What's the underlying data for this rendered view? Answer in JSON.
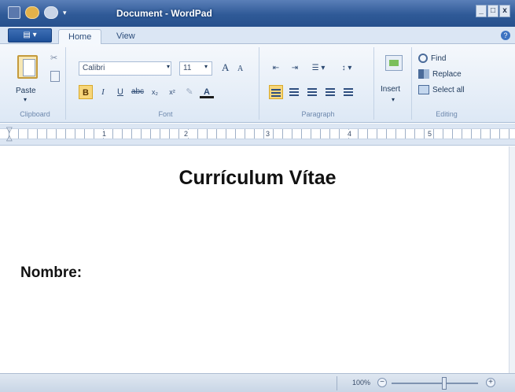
{
  "window": {
    "title": "Document - WordPad",
    "controls": {
      "minimize": "_",
      "maximize": "□",
      "close": "x"
    }
  },
  "quick_access": {
    "dropdown": "▾"
  },
  "ribbon": {
    "app_button": "▤ ▾",
    "tabs": [
      {
        "label": "Home"
      },
      {
        "label": "View"
      }
    ],
    "help": "?",
    "clipboard": {
      "paste": "Paste",
      "paste_arrow": "▾",
      "cut": "✂",
      "group": "Clipboard"
    },
    "font": {
      "name": "Calibri",
      "size": "11",
      "grow": "A",
      "shrink": "A",
      "buttons": {
        "bold": "B",
        "italic": "I",
        "underline": "U",
        "strike": "abc",
        "sub": "x₂",
        "sup": "x²",
        "highlight": "✎",
        "color": "A"
      },
      "group": "Font"
    },
    "paragraph": {
      "decrease_indent": "⇤",
      "increase_indent": "⇥",
      "list": "☰ ▾",
      "spacing": "↕ ▾",
      "group": "Paragraph"
    },
    "insert": {
      "label": "Insert",
      "arrow": "▾"
    },
    "editing": {
      "find": "Find",
      "replace": "Replace",
      "select_all": "Select all",
      "group": "Editing"
    }
  },
  "ruler": {
    "marks": [
      "1",
      "2",
      "3",
      "4",
      "5"
    ]
  },
  "document": {
    "title": "Currículum Vítae",
    "field_label": "Nombre:"
  },
  "status": {
    "zoom": "100%",
    "zoom_level": 0.6,
    "zoom_out": "−",
    "zoom_in": "+"
  }
}
